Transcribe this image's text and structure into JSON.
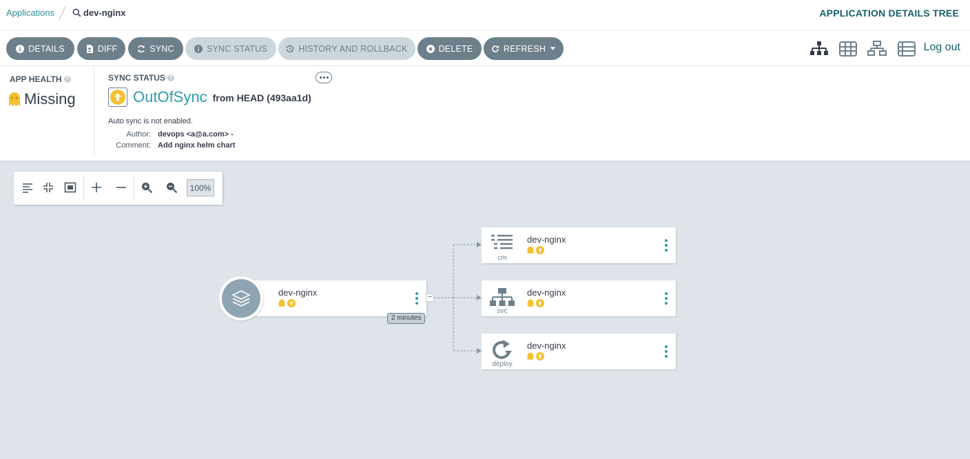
{
  "breadcrumb": {
    "applications": "Applications",
    "current": "dev-nginx"
  },
  "page_title": "APPLICATION DETAILS TREE",
  "toolbar": {
    "details": "DETAILS",
    "diff": "DIFF",
    "sync": "SYNC",
    "sync_status": "SYNC STATUS",
    "history": "HISTORY AND ROLLBACK",
    "delete": "DELETE",
    "refresh": "REFRESH",
    "logout": "Log out"
  },
  "app_health": {
    "label": "APP HEALTH",
    "value": "Missing"
  },
  "sync_status": {
    "label": "SYNC STATUS",
    "value": "OutOfSync",
    "revision": "from HEAD (493aa1d)",
    "auto_sync": "Auto sync is not enabled.",
    "author_label": "Author:",
    "author": "devops <a@a.com> -",
    "comment_label": "Comment:",
    "comment": "Add nginx helm chart"
  },
  "zoom": {
    "level": "100%"
  },
  "tree": {
    "app": {
      "name": "dev-nginx",
      "age": "2 minutes"
    },
    "resources": [
      {
        "name": "dev-nginx",
        "kind": "cm"
      },
      {
        "name": "dev-nginx",
        "kind": "svc"
      },
      {
        "name": "dev-nginx",
        "kind": "deploy"
      }
    ]
  },
  "colors": {
    "accent": "#2d9cad",
    "button": "#6d7f8b",
    "missing": "#f4c030",
    "canvas": "#dee4ea"
  }
}
